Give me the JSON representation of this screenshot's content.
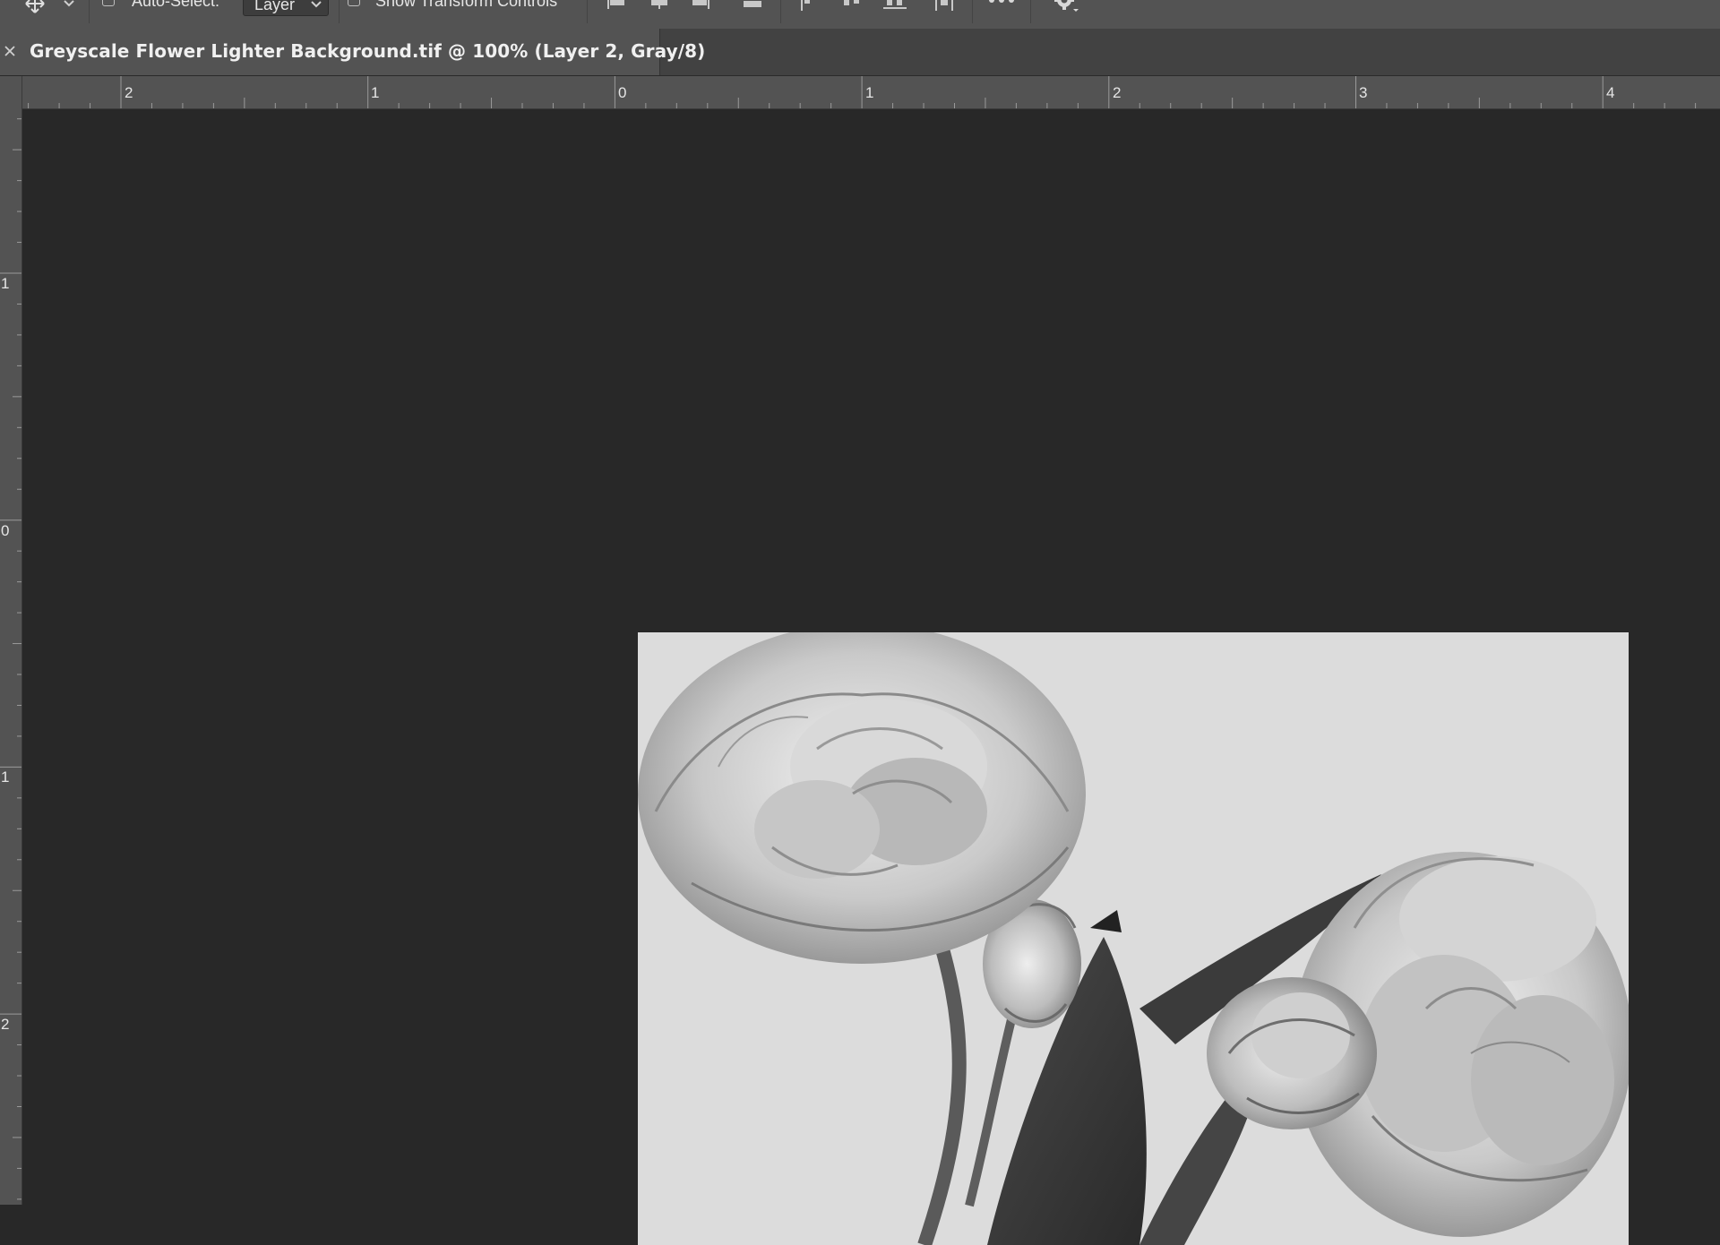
{
  "options_bar": {
    "auto_select_label": "Auto-Select:",
    "auto_select_value": "Layer",
    "show_transform_label": "Show Transform Controls"
  },
  "document": {
    "tab_title": "Greyscale Flower Lighter Background.tif @ 100% (Layer 2, Gray/8)"
  },
  "ruler_top_labels": [
    "2",
    "1",
    "0",
    "1",
    "2",
    "3",
    "4"
  ],
  "ruler_left_labels": [
    "1",
    "0",
    "1",
    "2"
  ]
}
